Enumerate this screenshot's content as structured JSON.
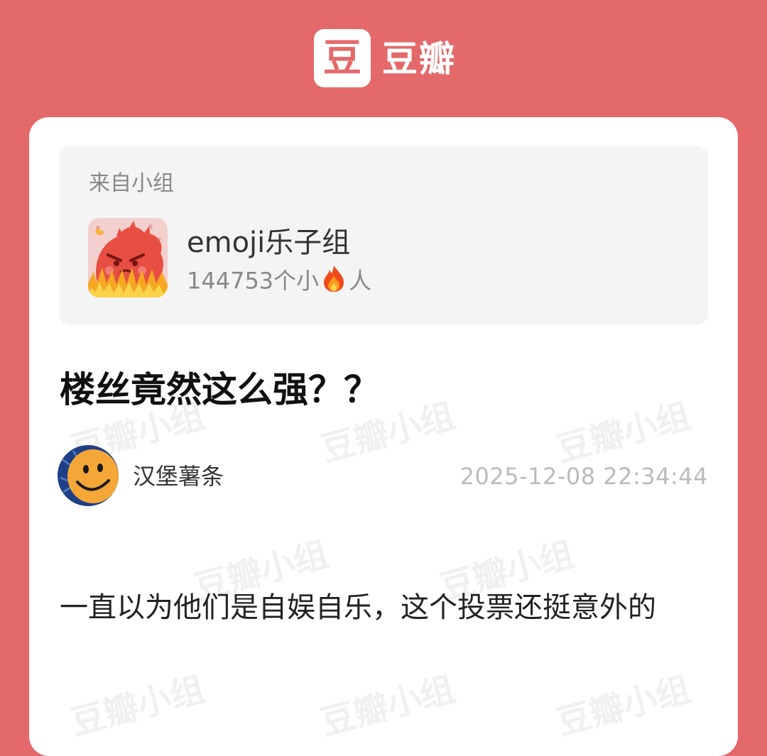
{
  "app": {
    "logo_glyph": "豆",
    "name": "豆瓣"
  },
  "group": {
    "from_label": "来自小组",
    "name": "emoji乐子组",
    "members_prefix": "144753个小",
    "members_suffix": "人"
  },
  "post": {
    "title": "楼丝竟然这么强？？",
    "author": "汉堡薯条",
    "time": "2025-12-08 22:34:44",
    "body": "一直以为他们是自娱自乐，这个投票还挺意外的"
  },
  "watermark": "豆瓣小组",
  "icons": {
    "logo": "douban-logo-icon",
    "group_avatar": "red-monster-fire-avatar",
    "fire": "fire-emoji-icon",
    "author_avatar": "smiley-face-avatar"
  },
  "colors": {
    "brand_bg": "#e4696a",
    "card_bg": "#ffffff",
    "group_box_bg": "#f4f4f4",
    "muted_text": "#888888",
    "time_text": "#bbbbbb"
  }
}
